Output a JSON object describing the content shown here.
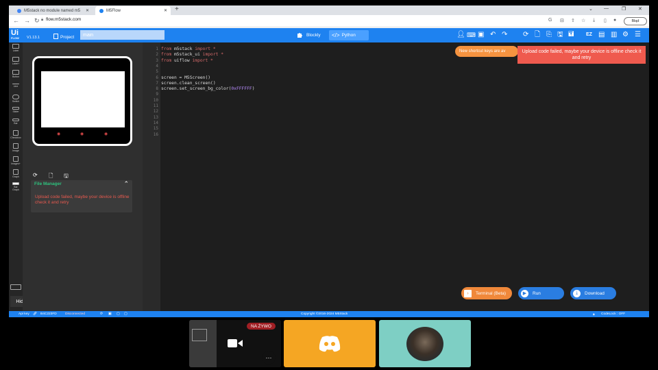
{
  "browser": {
    "tabs": [
      {
        "label": "M5stack no module named m5"
      },
      {
        "label": "M5Flow"
      }
    ],
    "url": "flow.m5stack.com",
    "profile_label": "Błąd",
    "window_controls": [
      "chevron-down-icon",
      "minimize-icon",
      "restore-icon",
      "close-icon"
    ]
  },
  "header": {
    "logo_text": "Ui",
    "logo_sub": "FLOW",
    "version": "V1.13.1",
    "project_label": "Project",
    "project_name": "main",
    "modes": {
      "blockly": "Blockly",
      "python": "Python"
    },
    "right_icons": [
      "user-icon",
      "keyboard-icon",
      "screen-icon",
      "undo-icon",
      "redo-icon",
      "refresh-icon",
      "new-file-icon",
      "open-file-icon",
      "save-icon",
      "save-as-icon",
      "ez-data-icon",
      "api-icon",
      "device-icon",
      "settings-icon",
      "menu-icon"
    ]
  },
  "toolbar": {
    "items": [
      "Label",
      "Label+",
      "Button",
      "Line",
      "Switch",
      "Slider",
      "Bar",
      "Checkbox",
      "Image",
      "Images+",
      "Graph",
      "Bar Graph"
    ],
    "hide_ui": "Hide UI"
  },
  "file_manager": {
    "title": "File Manager",
    "error": "Upload code failed, maybe your device is offline check it and retry"
  },
  "editor": {
    "lines": [
      {
        "n": "1",
        "tokens": [
          {
            "t": "from",
            "c": "kw"
          },
          {
            "t": " m5stack ",
            "c": ""
          },
          {
            "t": "import",
            "c": "kw"
          },
          {
            "t": " *",
            "c": "kw"
          }
        ]
      },
      {
        "n": "2",
        "tokens": [
          {
            "t": "from",
            "c": "kw"
          },
          {
            "t": " m5stack_ui ",
            "c": ""
          },
          {
            "t": "import",
            "c": "kw"
          },
          {
            "t": " *",
            "c": "kw"
          }
        ]
      },
      {
        "n": "3",
        "tokens": [
          {
            "t": "from",
            "c": "kw"
          },
          {
            "t": " uiflow ",
            "c": ""
          },
          {
            "t": "import",
            "c": "kw"
          },
          {
            "t": " *",
            "c": "kw"
          }
        ]
      },
      {
        "n": "4",
        "tokens": []
      },
      {
        "n": "5",
        "tokens": []
      },
      {
        "n": "6",
        "tokens": [
          {
            "t": "screen = M5Screen()",
            "c": ""
          }
        ]
      },
      {
        "n": "7",
        "tokens": [
          {
            "t": "screen.clean_screen()",
            "c": ""
          }
        ]
      },
      {
        "n": "8",
        "tokens": [
          {
            "t": "screen.set_screen_bg_color(",
            "c": ""
          },
          {
            "t": "0xFFFFFF",
            "c": "hex"
          },
          {
            "t": ")",
            "c": ""
          }
        ]
      },
      {
        "n": "9",
        "tokens": []
      },
      {
        "n": "10",
        "tokens": []
      },
      {
        "n": "11",
        "tokens": []
      },
      {
        "n": "12",
        "tokens": []
      },
      {
        "n": "13",
        "tokens": []
      },
      {
        "n": "14",
        "tokens": []
      },
      {
        "n": "15",
        "tokens": []
      },
      {
        "n": "16",
        "tokens": []
      }
    ]
  },
  "notifications": {
    "shortcut": "New shortcut keys are av",
    "upload_error": "Upload code failed, maybe your device is offline check it and retry"
  },
  "actions": {
    "terminal": "Terminal (Beta)",
    "run": "Run",
    "download": "Download"
  },
  "status": {
    "api_key_label": "Api key",
    "api_key": "B4C223FD",
    "connection": "Disconnected",
    "copyright": "Copyright ©2016-2024 M5Stack",
    "codelock": "CodeLock : OFF"
  },
  "call": {
    "live_badge": "NA ŻYWO",
    "more": "⋯"
  },
  "colors": {
    "brand": "#1e82f0",
    "error": "#ef5a4e",
    "warning": "#f59340",
    "discord": "#f5a623",
    "disconnected": "#e24b4b"
  }
}
